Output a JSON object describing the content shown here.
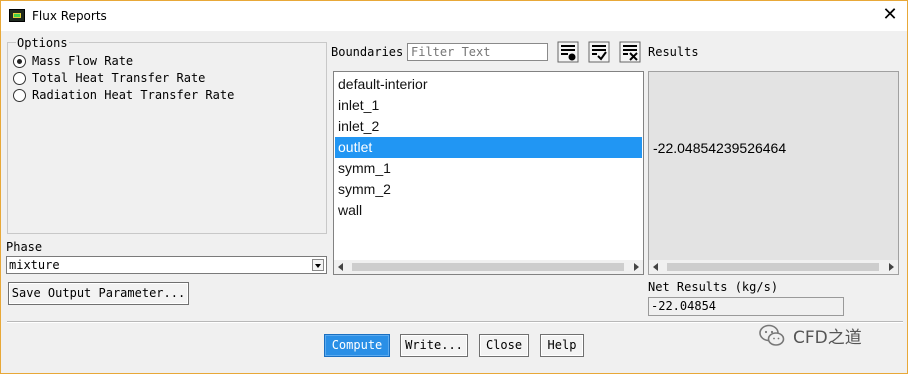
{
  "window": {
    "title": "Flux Reports",
    "close_glyph": "✕",
    "icon": "fluent-app-icon"
  },
  "options": {
    "legend": "Options",
    "items": [
      {
        "label": "Mass Flow Rate",
        "selected": true
      },
      {
        "label": "Total Heat Transfer Rate",
        "selected": false
      },
      {
        "label": "Radiation Heat Transfer Rate",
        "selected": false
      }
    ]
  },
  "phase": {
    "label": "Phase",
    "value": "mixture"
  },
  "save_button": "Save Output Parameter...",
  "boundaries": {
    "label": "Boundaries",
    "filter_placeholder": "Filter Text",
    "toolbar_icons": [
      "select-all-icon",
      "check-list-icon",
      "deselect-all-icon"
    ],
    "items": [
      "default-interior",
      "inlet_1",
      "inlet_2",
      "outlet",
      "symm_1",
      "symm_2",
      "wall"
    ],
    "selected": "outlet"
  },
  "results": {
    "label": "Results",
    "value": "-22.04854239526464"
  },
  "net_results": {
    "label": "Net Results (kg/s)",
    "value": "-22.04854"
  },
  "buttons": {
    "compute": "Compute",
    "write": "Write...",
    "close": "Close",
    "help": "Help"
  },
  "watermark": {
    "text": "CFD之道",
    "icon": "wechat-icon"
  }
}
